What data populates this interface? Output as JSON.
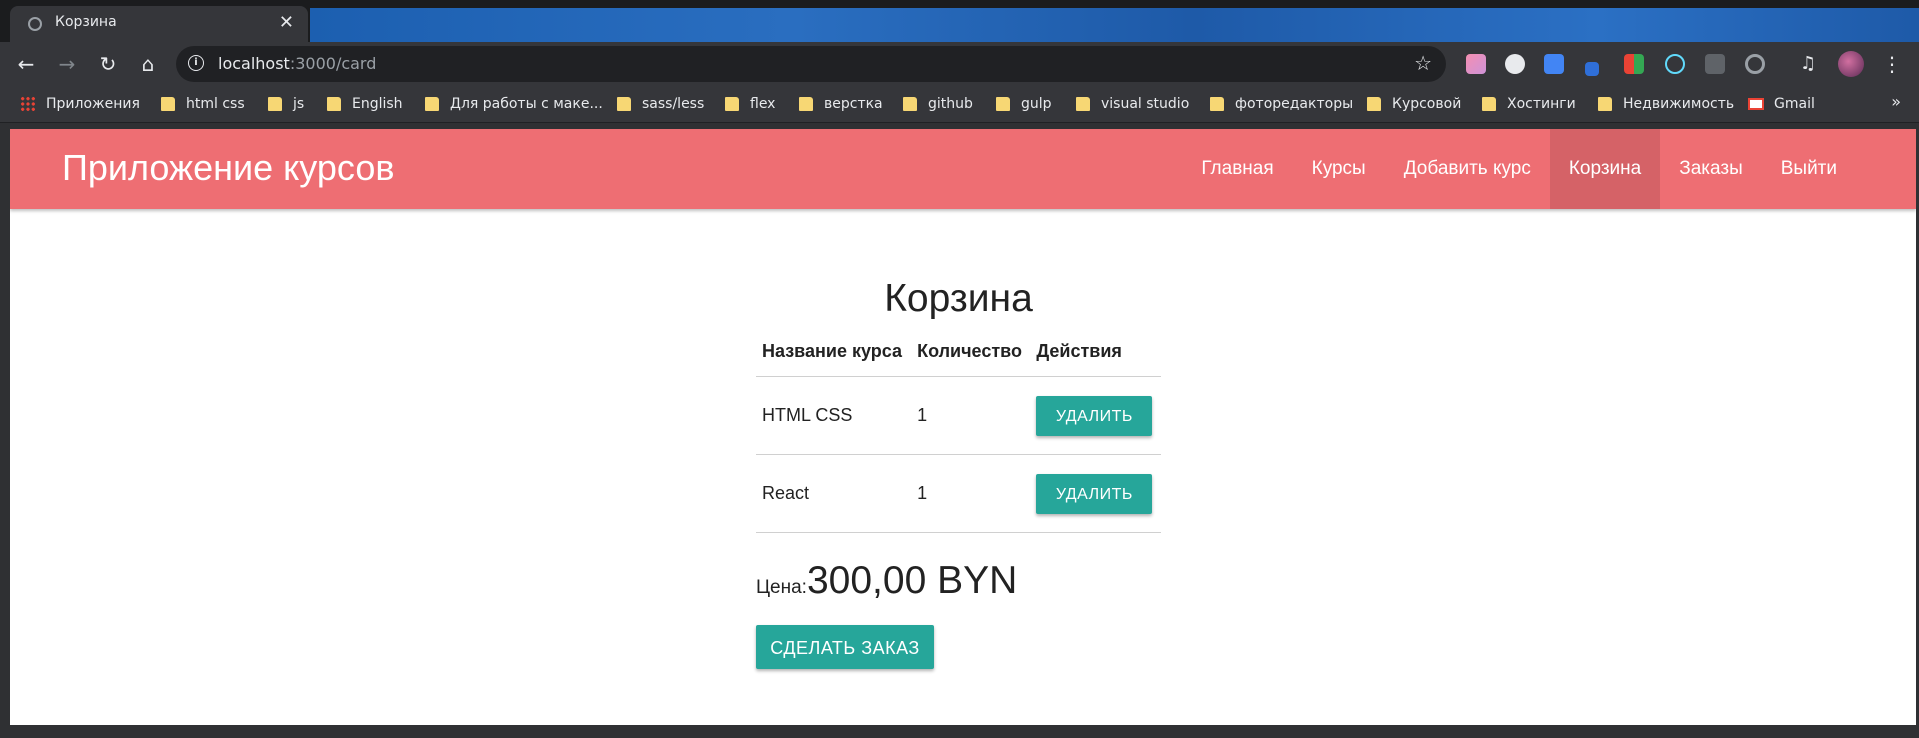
{
  "browser": {
    "tab_title": "Корзина",
    "url_host": "localhost",
    "url_path": ":3000/card"
  },
  "bookmarks": [
    {
      "label": "Приложения",
      "icon": "apps-icon"
    },
    {
      "label": "html css",
      "icon": "folder-icon"
    },
    {
      "label": "js",
      "icon": "folder-icon"
    },
    {
      "label": "English",
      "icon": "folder-icon"
    },
    {
      "label": "Для работы с маке...",
      "icon": "folder-icon"
    },
    {
      "label": "sass/less",
      "icon": "folder-icon"
    },
    {
      "label": "flex",
      "icon": "folder-icon"
    },
    {
      "label": "верстка",
      "icon": "folder-icon"
    },
    {
      "label": "github",
      "icon": "folder-icon"
    },
    {
      "label": "gulp",
      "icon": "folder-icon"
    },
    {
      "label": "visual studio",
      "icon": "folder-icon"
    },
    {
      "label": "фоторедакторы",
      "icon": "folder-icon"
    },
    {
      "label": "Курсовой",
      "icon": "folder-icon"
    },
    {
      "label": "Хостинги",
      "icon": "folder-icon"
    },
    {
      "label": "Недвижимость",
      "icon": "folder-icon"
    },
    {
      "label": "Gmail",
      "icon": "gmail-icon"
    }
  ],
  "navbar": {
    "brand": "Приложение курсов",
    "links": [
      "Главная",
      "Курсы",
      "Добавить курс",
      "Корзина",
      "Заказы",
      "Выйти"
    ],
    "active": "Корзина",
    "color": "#ee6e73"
  },
  "cart": {
    "title": "Корзина",
    "headers": [
      "Название курса",
      "Количество",
      "Действия"
    ],
    "rows": [
      {
        "name": "HTML CSS",
        "qty": "1",
        "action": "УДАЛИТЬ"
      },
      {
        "name": "React",
        "qty": "1",
        "action": "УДАЛИТЬ"
      }
    ],
    "price_label": "Цена:",
    "price_value": "300,00 BYN",
    "order_button": "СДЕЛАТЬ ЗАКАЗ",
    "button_color": "#26a69a"
  }
}
